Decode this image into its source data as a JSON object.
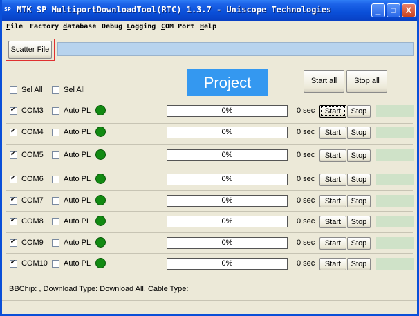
{
  "window": {
    "title": "MTK SP MultiportDownloadTool(RTC) 1.3.7 - Uniscope Technologies",
    "icon": "SP",
    "controls": {
      "minimize": "_",
      "maximize": "□",
      "close": "X"
    }
  },
  "menu": {
    "file": {
      "key": "F",
      "rest": "ile"
    },
    "factory": {
      "pre": "Factory ",
      "key": "d",
      "rest": "atabase"
    },
    "debug": {
      "pre": "Debug ",
      "key": "L",
      "rest": "ogging"
    },
    "com": {
      "key": "C",
      "rest": "OM Port"
    },
    "help": {
      "key": "H",
      "rest": "elp"
    }
  },
  "toolbar": {
    "scatter_file_label": "Scatter File",
    "scatter_path": ""
  },
  "header": {
    "sel_all_1": "Sel All",
    "sel_all_2": "Sel All",
    "project_label": "Project",
    "start_all_label": "Start all",
    "stop_all_label": "Stop all"
  },
  "ports": [
    {
      "com": "COM3",
      "auto_pl": "Auto PL",
      "progress_text": "0%",
      "time": "0 sec",
      "start": "Start",
      "stop": "Stop",
      "checked": true
    },
    {
      "com": "COM4",
      "auto_pl": "Auto PL",
      "progress_text": "0%",
      "time": "0 sec",
      "start": "Start",
      "stop": "Stop",
      "checked": true
    },
    {
      "com": "COM5",
      "auto_pl": "Auto PL",
      "progress_text": "0%",
      "time": "0 sec",
      "start": "Start",
      "stop": "Stop",
      "checked": true
    },
    {
      "com": "COM6",
      "auto_pl": "Auto PL",
      "progress_text": "0%",
      "time": "0 sec",
      "start": "Start",
      "stop": "Stop",
      "checked": true
    },
    {
      "com": "COM7",
      "auto_pl": "Auto PL",
      "progress_text": "0%",
      "time": "0 sec",
      "start": "Start",
      "stop": "Stop",
      "checked": true
    },
    {
      "com": "COM8",
      "auto_pl": "Auto PL",
      "progress_text": "0%",
      "time": "0 sec",
      "start": "Start",
      "stop": "Stop",
      "checked": true
    },
    {
      "com": "COM9",
      "auto_pl": "Auto PL",
      "progress_text": "0%",
      "time": "0 sec",
      "start": "Start",
      "stop": "Stop",
      "checked": true
    },
    {
      "com": "COM10",
      "auto_pl": "Auto PL",
      "progress_text": "0%",
      "time": "0 sec",
      "start": "Start",
      "stop": "Stop",
      "checked": true
    }
  ],
  "status_bar": {
    "text": "BBChip: ,  Download Type: Download All,  Cable Type:"
  },
  "colors": {
    "titlebar": "#0a4fd8",
    "led_green": "#128a12",
    "project_bg": "#3498f0",
    "status_box": "#cfe2c8"
  }
}
